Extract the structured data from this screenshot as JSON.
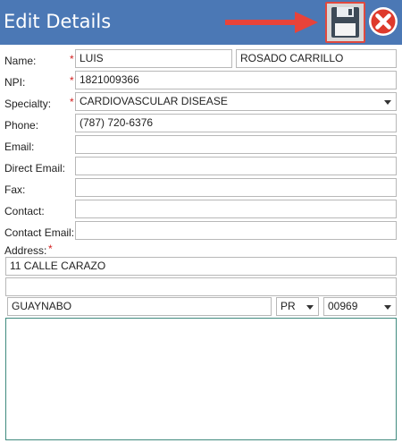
{
  "header": {
    "title": "Edit Details",
    "bg_color": "#4b78b5",
    "save_icon": "floppy-disk-icon",
    "close_icon": "close-x-icon",
    "arrow_icon": "red-arrow-icon"
  },
  "form": {
    "name": {
      "label": "Name:",
      "required": "*",
      "first": "LUIS",
      "last": "ROSADO CARRILLO"
    },
    "npi": {
      "label": "NPI:",
      "required": "*",
      "value": "1821009366"
    },
    "specialty": {
      "label": "Specialty:",
      "required": "*",
      "value": "CARDIOVASCULAR DISEASE"
    },
    "phone": {
      "label": "Phone:",
      "value": "(787) 720-6376"
    },
    "email": {
      "label": "Email:",
      "value": ""
    },
    "direct_email": {
      "label": "Direct Email:",
      "value": ""
    },
    "fax": {
      "label": "Fax:",
      "value": ""
    },
    "contact": {
      "label": "Contact:",
      "value": ""
    },
    "contact_email": {
      "label": "Contact Email:",
      "value": ""
    },
    "address": {
      "label": "Address:",
      "required": "*",
      "line1": "11 CALLE CARAZO",
      "line2": "",
      "city": "GUAYNABO",
      "state": "PR",
      "zip": "00969"
    },
    "notes": ""
  }
}
